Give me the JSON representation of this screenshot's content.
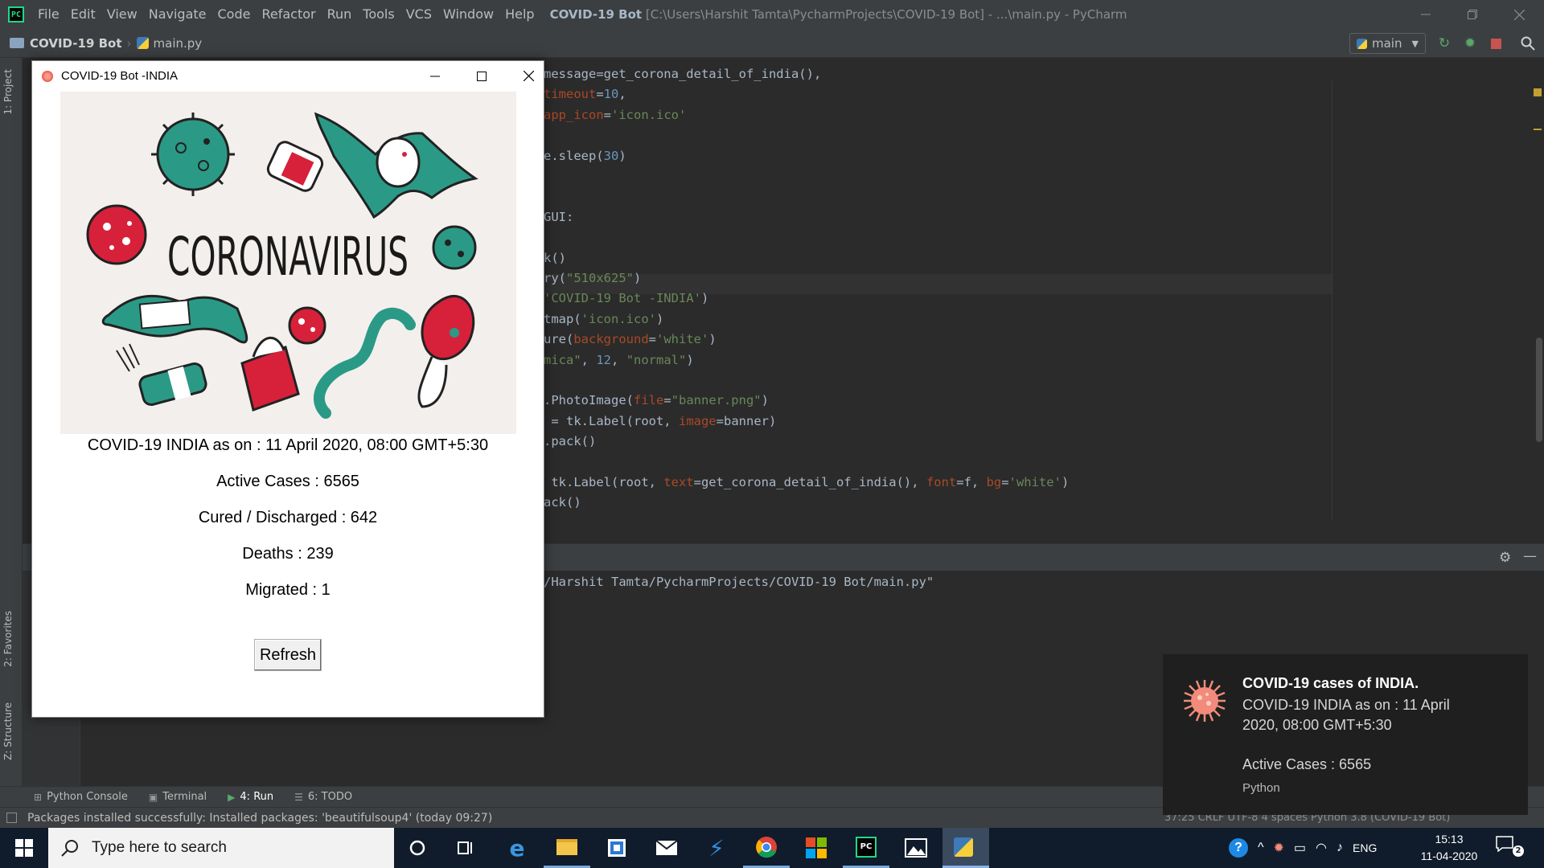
{
  "ide": {
    "menu": [
      "File",
      "Edit",
      "View",
      "Navigate",
      "Code",
      "Refactor",
      "Run",
      "Tools",
      "VCS",
      "Window",
      "Help"
    ],
    "title_project": "COVID-19 Bot",
    "title_rest": "[C:\\Users\\Harshit Tamta\\PycharmProjects\\COVID-19 Bot] - ...\\main.py - PyCharm",
    "breadcrumb_project": "COVID-19 Bot",
    "breadcrumb_file": "main.py",
    "run_config": "main",
    "side_tabs": {
      "project": "1: Project",
      "favorites": "2: Favorites",
      "structure": "Z: Structure"
    },
    "code_lines": [
      {
        "segs": [
          [
            "message=get_corona_detail_of_india(),",
            ""
          ]
        ]
      },
      {
        "segs": [
          [
            "timeout",
            "par"
          ],
          [
            "=",
            ""
          ],
          [
            "10",
            "num"
          ],
          [
            ",",
            ""
          ]
        ]
      },
      {
        "segs": [
          [
            "app_icon",
            "par"
          ],
          [
            "=",
            ""
          ],
          [
            "'icon.ico'",
            "str"
          ]
        ]
      },
      {
        "segs": []
      },
      {
        "segs": [
          [
            "e.sleep(",
            ""
          ],
          [
            "30",
            "num"
          ],
          [
            ")",
            ""
          ]
        ]
      },
      {
        "segs": []
      },
      {
        "segs": []
      },
      {
        "segs": [
          [
            "GUI:",
            ""
          ]
        ]
      },
      {
        "segs": []
      },
      {
        "segs": [
          [
            "k()",
            ""
          ]
        ]
      },
      {
        "segs": [
          [
            "ry(",
            ""
          ],
          [
            "\"510x625\"",
            "str"
          ],
          [
            ")",
            ""
          ]
        ]
      },
      {
        "segs": [
          [
            "'COVID-19 Bot -INDIA'",
            "str"
          ],
          [
            ")",
            ""
          ]
        ]
      },
      {
        "segs": [
          [
            "tmap(",
            ""
          ],
          [
            "'icon.ico'",
            "str"
          ],
          [
            ")",
            ""
          ]
        ]
      },
      {
        "segs": [
          [
            "ure(",
            ""
          ],
          [
            "background",
            "par"
          ],
          [
            "=",
            ""
          ],
          [
            "'white'",
            "str"
          ],
          [
            ")",
            ""
          ]
        ]
      },
      {
        "segs": [
          [
            "mica\"",
            "str"
          ],
          [
            ", ",
            ""
          ],
          [
            "12",
            "num"
          ],
          [
            ", ",
            ""
          ],
          [
            "\"normal\"",
            "str"
          ],
          [
            ")",
            ""
          ]
        ]
      },
      {
        "segs": []
      },
      {
        "segs": [
          [
            ".PhotoImage(",
            ""
          ],
          [
            "file",
            "par"
          ],
          [
            "=",
            ""
          ],
          [
            "\"banner.png\"",
            "str"
          ],
          [
            ")",
            ""
          ]
        ]
      },
      {
        "segs": [
          [
            " = tk.Label(root, ",
            ""
          ],
          [
            "image",
            "par"
          ],
          [
            "=banner)",
            ""
          ]
        ]
      },
      {
        "segs": [
          [
            ".pack()",
            ""
          ]
        ]
      },
      {
        "segs": []
      },
      {
        "segs": [
          [
            " tk.Label(root, ",
            ""
          ],
          [
            "text",
            "par"
          ],
          [
            "=get_corona_detail_of_india(), ",
            ""
          ],
          [
            "font",
            "par"
          ],
          [
            "=f, ",
            ""
          ],
          [
            "bg",
            "par"
          ],
          [
            "=",
            ""
          ],
          [
            "'white'",
            "str"
          ],
          [
            ")",
            ""
          ]
        ]
      },
      {
        "segs": [
          [
            "ack()",
            ""
          ]
        ]
      }
    ],
    "run_output": "ers/Harshit Tamta/PycharmProjects/COVID-19 Bot/main.py\"",
    "bottom_tabs": [
      {
        "label": "Python Console",
        "icon": "python-console-icon"
      },
      {
        "label": "Terminal",
        "icon": "terminal-icon"
      },
      {
        "label": "4: Run",
        "icon": "run-icon"
      },
      {
        "label": "6: TODO",
        "icon": "todo-icon"
      }
    ],
    "status_text": "Packages installed successfully: Installed packages: 'beautifulsoup4' (today 09:27)",
    "status_right": "37:25   CRLF   UTF-8   4 spaces   Python 3.8 (COVID-19 Bot)"
  },
  "tk_app": {
    "title": "COVID-19 Bot -INDIA",
    "banner_text": "CORONAVIRUS",
    "updated": "COVID-19 INDIA as on : 11 April 2020, 08:00 GMT+5:30",
    "active": "Active Cases : 6565",
    "cured": "Cured / Discharged  : 642",
    "deaths": "Deaths : 239",
    "migrated": "Migrated : 1",
    "refresh_label": "Refresh"
  },
  "toast": {
    "title": "COVID-19 cases of INDIA.",
    "body": "COVID-19 INDIA as on : 11 April 2020, 08:00 GMT+5:30",
    "active": "Active Cases : 6565",
    "source": "Python"
  },
  "taskbar": {
    "search_placeholder": "Type here to search",
    "lang": "ENG",
    "time": "15:13",
    "date": "11-04-2020",
    "notification_count": "2"
  },
  "colors": {
    "accent_red": "#d7213a",
    "accent_teal": "#2a9a86",
    "ide_bg": "#2b2b2b",
    "taskbar": "#101c2b"
  }
}
